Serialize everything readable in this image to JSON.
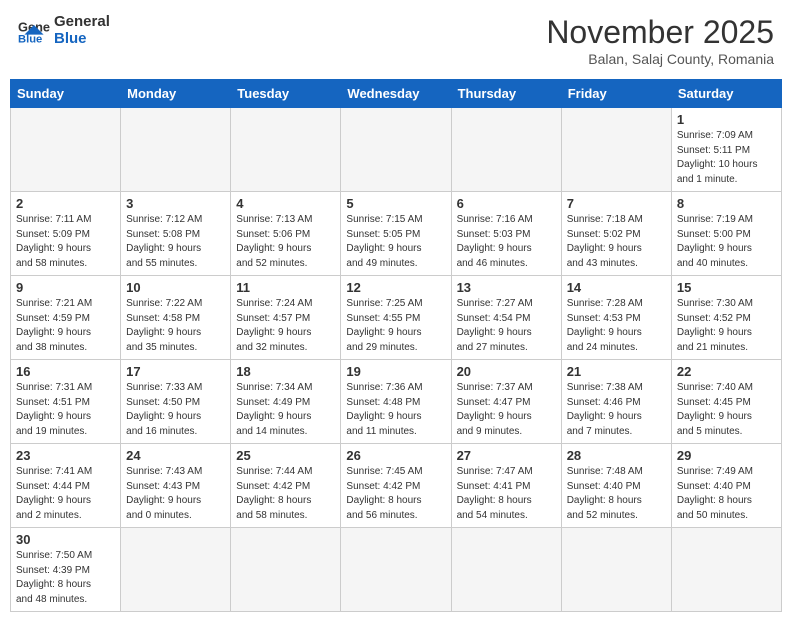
{
  "header": {
    "logo_general": "General",
    "logo_blue": "Blue",
    "month": "November 2025",
    "location": "Balan, Salaj County, Romania"
  },
  "weekdays": [
    "Sunday",
    "Monday",
    "Tuesday",
    "Wednesday",
    "Thursday",
    "Friday",
    "Saturday"
  ],
  "weeks": [
    [
      {
        "day": "",
        "info": ""
      },
      {
        "day": "",
        "info": ""
      },
      {
        "day": "",
        "info": ""
      },
      {
        "day": "",
        "info": ""
      },
      {
        "day": "",
        "info": ""
      },
      {
        "day": "",
        "info": ""
      },
      {
        "day": "1",
        "info": "Sunrise: 7:09 AM\nSunset: 5:11 PM\nDaylight: 10 hours\nand 1 minute."
      }
    ],
    [
      {
        "day": "2",
        "info": "Sunrise: 7:11 AM\nSunset: 5:09 PM\nDaylight: 9 hours\nand 58 minutes."
      },
      {
        "day": "3",
        "info": "Sunrise: 7:12 AM\nSunset: 5:08 PM\nDaylight: 9 hours\nand 55 minutes."
      },
      {
        "day": "4",
        "info": "Sunrise: 7:13 AM\nSunset: 5:06 PM\nDaylight: 9 hours\nand 52 minutes."
      },
      {
        "day": "5",
        "info": "Sunrise: 7:15 AM\nSunset: 5:05 PM\nDaylight: 9 hours\nand 49 minutes."
      },
      {
        "day": "6",
        "info": "Sunrise: 7:16 AM\nSunset: 5:03 PM\nDaylight: 9 hours\nand 46 minutes."
      },
      {
        "day": "7",
        "info": "Sunrise: 7:18 AM\nSunset: 5:02 PM\nDaylight: 9 hours\nand 43 minutes."
      },
      {
        "day": "8",
        "info": "Sunrise: 7:19 AM\nSunset: 5:00 PM\nDaylight: 9 hours\nand 40 minutes."
      }
    ],
    [
      {
        "day": "9",
        "info": "Sunrise: 7:21 AM\nSunset: 4:59 PM\nDaylight: 9 hours\nand 38 minutes."
      },
      {
        "day": "10",
        "info": "Sunrise: 7:22 AM\nSunset: 4:58 PM\nDaylight: 9 hours\nand 35 minutes."
      },
      {
        "day": "11",
        "info": "Sunrise: 7:24 AM\nSunset: 4:57 PM\nDaylight: 9 hours\nand 32 minutes."
      },
      {
        "day": "12",
        "info": "Sunrise: 7:25 AM\nSunset: 4:55 PM\nDaylight: 9 hours\nand 29 minutes."
      },
      {
        "day": "13",
        "info": "Sunrise: 7:27 AM\nSunset: 4:54 PM\nDaylight: 9 hours\nand 27 minutes."
      },
      {
        "day": "14",
        "info": "Sunrise: 7:28 AM\nSunset: 4:53 PM\nDaylight: 9 hours\nand 24 minutes."
      },
      {
        "day": "15",
        "info": "Sunrise: 7:30 AM\nSunset: 4:52 PM\nDaylight: 9 hours\nand 21 minutes."
      }
    ],
    [
      {
        "day": "16",
        "info": "Sunrise: 7:31 AM\nSunset: 4:51 PM\nDaylight: 9 hours\nand 19 minutes."
      },
      {
        "day": "17",
        "info": "Sunrise: 7:33 AM\nSunset: 4:50 PM\nDaylight: 9 hours\nand 16 minutes."
      },
      {
        "day": "18",
        "info": "Sunrise: 7:34 AM\nSunset: 4:49 PM\nDaylight: 9 hours\nand 14 minutes."
      },
      {
        "day": "19",
        "info": "Sunrise: 7:36 AM\nSunset: 4:48 PM\nDaylight: 9 hours\nand 11 minutes."
      },
      {
        "day": "20",
        "info": "Sunrise: 7:37 AM\nSunset: 4:47 PM\nDaylight: 9 hours\nand 9 minutes."
      },
      {
        "day": "21",
        "info": "Sunrise: 7:38 AM\nSunset: 4:46 PM\nDaylight: 9 hours\nand 7 minutes."
      },
      {
        "day": "22",
        "info": "Sunrise: 7:40 AM\nSunset: 4:45 PM\nDaylight: 9 hours\nand 5 minutes."
      }
    ],
    [
      {
        "day": "23",
        "info": "Sunrise: 7:41 AM\nSunset: 4:44 PM\nDaylight: 9 hours\nand 2 minutes."
      },
      {
        "day": "24",
        "info": "Sunrise: 7:43 AM\nSunset: 4:43 PM\nDaylight: 9 hours\nand 0 minutes."
      },
      {
        "day": "25",
        "info": "Sunrise: 7:44 AM\nSunset: 4:42 PM\nDaylight: 8 hours\nand 58 minutes."
      },
      {
        "day": "26",
        "info": "Sunrise: 7:45 AM\nSunset: 4:42 PM\nDaylight: 8 hours\nand 56 minutes."
      },
      {
        "day": "27",
        "info": "Sunrise: 7:47 AM\nSunset: 4:41 PM\nDaylight: 8 hours\nand 54 minutes."
      },
      {
        "day": "28",
        "info": "Sunrise: 7:48 AM\nSunset: 4:40 PM\nDaylight: 8 hours\nand 52 minutes."
      },
      {
        "day": "29",
        "info": "Sunrise: 7:49 AM\nSunset: 4:40 PM\nDaylight: 8 hours\nand 50 minutes."
      }
    ],
    [
      {
        "day": "30",
        "info": "Sunrise: 7:50 AM\nSunset: 4:39 PM\nDaylight: 8 hours\nand 48 minutes."
      },
      {
        "day": "",
        "info": ""
      },
      {
        "day": "",
        "info": ""
      },
      {
        "day": "",
        "info": ""
      },
      {
        "day": "",
        "info": ""
      },
      {
        "day": "",
        "info": ""
      },
      {
        "day": "",
        "info": ""
      }
    ]
  ]
}
